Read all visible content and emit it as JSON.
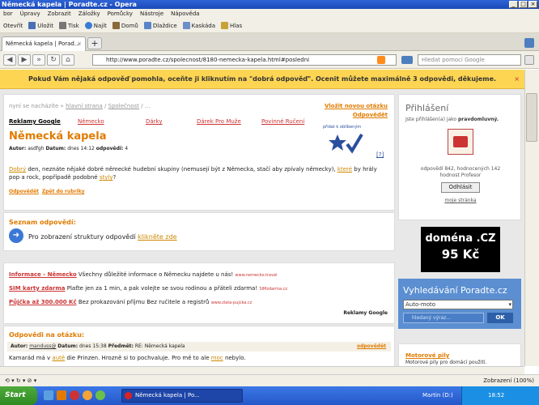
{
  "window": {
    "title": "Německá kapela | Poradte.cz - Opera",
    "controls": [
      "_",
      "□",
      "×"
    ]
  },
  "menu": [
    "bor",
    "Úpravy",
    "Zobrazit",
    "Záložky",
    "Pomůcky",
    "Nástroje",
    "Nápověda"
  ],
  "toolbar": [
    "Otevřít",
    "Uložit",
    "Tisk",
    "Najít",
    "Domů",
    "Dlaždice",
    "Kaskáda",
    "Hlas"
  ],
  "tab": {
    "label": "Německá kapela | Porad...",
    "close": "×",
    "new": "+"
  },
  "address": {
    "url": "http://www.poradte.cz/spolecnost/8180-nemecka-kapela.html#posledni",
    "search_placeholder": "Hledat pomocí Google"
  },
  "notice": {
    "text": "Pokud Vám nějaká odpověď pomohla, oceňte ji kliknutím na \"dobrá odpověď\". Ocenit můžete maximálně 3 odpovědi, děkujeme.",
    "close": "×"
  },
  "question": {
    "breadcrumb_prefix": "nyní se nacházíte »",
    "crumb_home": "hlavní strana",
    "crumb_sep": "/",
    "crumb_cat": "Společnost",
    "crumb_tail": "/ ...",
    "new_question": "Vložit novou otázku",
    "answer_link": "Odpovědět",
    "ads_title": "Reklamy Google",
    "ads": [
      "Německo",
      "Dárky",
      "Dárek Pro Muže",
      "Povinné Ručení"
    ],
    "title": "Německá kapela",
    "meta": {
      "author_label": "Autor:",
      "author": "asdfgh",
      "date_label": "Datum:",
      "date": "dnes 14:12",
      "answers_label": "odpovědí:",
      "answers": "4"
    },
    "badge": "přidat k oblíbeným",
    "help": "[?]",
    "body_w1": "Dobrý",
    "body_t1": " den, neznáte nějaké dobré německé hudební skupiny (nemusejí být z Německa, stačí aby zpívaly německy), ",
    "body_w2": "které",
    "body_t2": " by hrály pop a rock, popřípadě podobné ",
    "body_w3": "styly",
    "body_t3": "?",
    "actions": [
      "Odpovědět",
      "Zpět do rubriky"
    ]
  },
  "answers_list": {
    "title": "Seznam odpovědí:",
    "text": "Pro zobrazení struktury odpovědí",
    "link": "klikněte zde"
  },
  "adblock": {
    "items": [
      {
        "title": "Informace - Německo",
        "text": " Všechny důležité informace o Německu najdete u nás! ",
        "url": "www.nemecko.travel"
      },
      {
        "title": "SIM karty zdarma",
        "text": " Plaťte jen za 1 min, a pak volejte se svou rodinou a přáteli zdarma! ",
        "url": "SIMzdarma.cz"
      },
      {
        "title": "Půjčka až 300.000 Kč",
        "text": " Bez prokazování příjmu Bez ručitele a registrů ",
        "url": "www.zlata-pujcka.cz"
      }
    ],
    "footer": "Reklamy Google"
  },
  "replies": {
    "title": "Odpovědi na otázku:",
    "author_label": "Autor:",
    "author": "manduss@",
    "date_label": "Datum:",
    "date": "dnes 15:38",
    "subject_label": "Předmět:",
    "subject": "RE: Německá kapela",
    "answer_link": "odpovědět",
    "text_a": "Kamarád má v ",
    "text_w1": "autě",
    "text_b": " die Prinzen. Hrozně si to pochvaluje. Pro mě to ale ",
    "text_w2": "moc",
    "text_c": " nebylo."
  },
  "login": {
    "title": "Přihlášení",
    "status_prefix": "Jste přihlášen(a) jako ",
    "status_name": "pravdomluvný.",
    "stats": "odpovědí 842, hodnocených 142",
    "rank": "hodnost Profesor",
    "logout": "Odhlásit",
    "my_page": "moje stránka"
  },
  "domain_ad": {
    "line1": "doména .CZ",
    "line2": "95 Kč"
  },
  "search_box": {
    "title": "Vyhledávání Poradte.cz",
    "select": "Auto-moto",
    "placeholder": "hledaný výraz...",
    "button": "OK"
  },
  "side_ad": {
    "title": "Motorové pily",
    "text": "Motorové pily pro domácí použití."
  },
  "status": {
    "zoom": "Zobrazení (100%)"
  },
  "taskbar": {
    "start": "Start",
    "task": "Německá kapela | Po...",
    "tray_label": "Martin (D:)",
    "time": "18:52"
  },
  "colors": {
    "accent": "#e07b00",
    "titlebar": "#2e63d6",
    "notice": "#fdd553",
    "search_panel": "#5b8fd1"
  }
}
